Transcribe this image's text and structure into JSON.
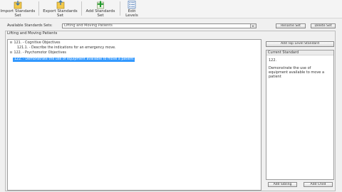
{
  "toolbar": {
    "import_label": "Import Standards Set",
    "export_label": "Export Standards Set",
    "add_label": "Add Standards Set",
    "edit_levels_label": "Edit Levels"
  },
  "standards_sets": {
    "label": "Available Standards Sets:",
    "selected": "Lifting and Moving Patients",
    "rename_button": "Rename Set",
    "delete_button": "Delete Set"
  },
  "group": {
    "title": "Lifting and Moving Patients",
    "add_top_level_button": "Add Top Level Standard"
  },
  "tree": [
    {
      "toggle": "⊟",
      "text": "121. - Cognitive Objectives",
      "selected": false
    },
    {
      "toggle": "",
      "text": "121.1. - Describe the indications for an emergency move.",
      "selected": false
    },
    {
      "toggle": "⊟",
      "text": "122. - Psychomotor Objectives",
      "selected": false
    },
    {
      "toggle": "",
      "text": "122. - Demonstrate the use of equipment available to move a patient",
      "selected": true
    }
  ],
  "current_standard": {
    "heading": "Current Standard",
    "number": "122.",
    "description": "Demonstrate the use of equipment available to move a patient"
  },
  "bottom_buttons": {
    "left": "Add Sibling",
    "right": "Add Child"
  }
}
